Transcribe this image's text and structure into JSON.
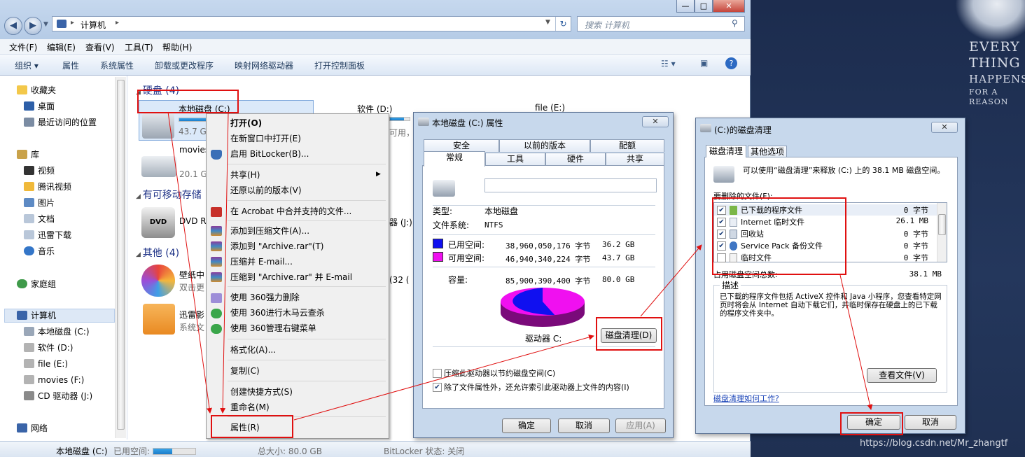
{
  "explorer": {
    "address": "计算机",
    "search_placeholder": "搜索 计算机",
    "menu": [
      "文件(F)",
      "编辑(E)",
      "查看(V)",
      "工具(T)",
      "帮助(H)"
    ],
    "toolbar": [
      "组织 ▾",
      "属性",
      "系统属性",
      "卸载或更改程序",
      "映射网络驱动器",
      "打开控制面板"
    ],
    "nav": {
      "favorites": "收藏夹",
      "fav_items": [
        "桌面",
        "最近访问的位置"
      ],
      "library": "库",
      "lib_items": [
        "视频",
        "腾讯视频",
        "图片",
        "文档",
        "迅雷下载",
        "音乐"
      ],
      "homegroup": "家庭组",
      "computer": "计算机",
      "comp_items": [
        "本地磁盘 (C:)",
        "软件 (D:)",
        "file (E:)",
        "movies (F:)",
        "CD 驱动器 (J:)"
      ],
      "network": "网络"
    },
    "groups": {
      "hdd": "硬盘 (4)",
      "removable": "有可移动存储",
      "other": "其他 (4)"
    },
    "drives": {
      "c_name": "本地磁盘 (C:)",
      "c_free": "43.7 G",
      "d_name": "软件 (D:)",
      "d_free": "可用，",
      "e_name": "file (E:)",
      "f_name": "movies",
      "f_free": "20.1 G",
      "dvd_name": "DVD R",
      "dvd_label": "DVD",
      "j_frag": "器 (J:)",
      "wall_name": "壁纸中",
      "wall_sub": "双击更",
      "wall_count": "(32 (",
      "xl_name": "迅雷影",
      "xl_sub": "系统文"
    },
    "status": {
      "name": "本地磁盘 (C:)",
      "used_label": "已用空间:",
      "used_fraction": 0.45,
      "total": "总大小: 80.0 GB",
      "bitlocker": "BitLocker 状态: 关闭"
    }
  },
  "context_menu": {
    "items": [
      {
        "label": "打开(O)",
        "bold": true
      },
      {
        "label": "在新窗口中打开(E)"
      },
      {
        "label": "启用 BitLocker(B)..."
      },
      {
        "label": "共享(H)",
        "submenu": true
      },
      {
        "label": "还原以前的版本(V)"
      },
      {
        "label": "在 Acrobat 中合并支持的文件..."
      },
      {
        "label": "添加到压缩文件(A)..."
      },
      {
        "label": "添加到 \"Archive.rar\"(T)"
      },
      {
        "label": "压缩并 E-mail..."
      },
      {
        "label": "压缩到 \"Archive.rar\" 并 E-mail"
      },
      {
        "label": "使用 360强力删除"
      },
      {
        "label": "使用 360进行木马云查杀"
      },
      {
        "label": "使用 360管理右键菜单"
      },
      {
        "label": "格式化(A)..."
      },
      {
        "label": "复制(C)"
      },
      {
        "label": "创建快捷方式(S)"
      },
      {
        "label": "重命名(M)"
      },
      {
        "label": "属性(R)"
      }
    ]
  },
  "props": {
    "title": "本地磁盘 (C:) 属性",
    "tabs_back": [
      "安全",
      "以前的版本",
      "配额"
    ],
    "tabs_front": [
      "常规",
      "工具",
      "硬件",
      "共享"
    ],
    "type_label": "类型:",
    "type_value": "本地磁盘",
    "fs_label": "文件系统:",
    "fs_value": "NTFS",
    "used_label": "已用空间:",
    "used_bytes": "38,960,050,176 字节",
    "used_gb": "36.2 GB",
    "free_label": "可用空间:",
    "free_bytes": "46,940,340,224 字节",
    "free_gb": "43.7 GB",
    "cap_label": "容量:",
    "cap_bytes": "85,900,390,400 字节",
    "cap_gb": "80.0 GB",
    "drive_label": "驱动器 C:",
    "cleanup_btn": "磁盘清理(D)",
    "compress": "压缩此驱动器以节约磁盘空间(C)",
    "index": "除了文件属性外，还允许索引此驱动器上文件的内容(I)",
    "ok": "确定",
    "cancel": "取消",
    "apply": "应用(A)",
    "colors": {
      "used": "#1010f0",
      "free": "#f010f0"
    },
    "used_fraction": 0.4535
  },
  "cleanup": {
    "title": "(C:)的磁盘清理",
    "tabs": [
      "磁盘清理",
      "其他选项"
    ],
    "intro": "可以使用“磁盘清理”来释放 (C:) 上的 38.1 MB 磁盘空间。",
    "delete_label": "要删除的文件(F):",
    "files": [
      {
        "name": "已下载的程序文件",
        "size": "0 字节",
        "checked": true
      },
      {
        "name": "Internet 临时文件",
        "size": "26.1 MB",
        "checked": true
      },
      {
        "name": "回收站",
        "size": "0 字节",
        "checked": true
      },
      {
        "name": "Service Pack 备份文件",
        "size": "0 字节",
        "checked": true
      },
      {
        "name": "临时文件",
        "size": "0 字节",
        "checked": false
      }
    ],
    "total_label": "占用磁盘空间总数:",
    "total": "38.1 MB",
    "desc_label": "描述",
    "desc": "已下载的程序文件包括 ActiveX 控件和 Java 小程序，您查看特定网页时将会从 Internet 自动下载它们，并临时保存在硬盘上的已下载的程序文件夹中。",
    "view_btn": "查看文件(V)",
    "help_link": "磁盘清理如何工作?",
    "ok": "确定",
    "cancel": "取消"
  },
  "wallpaper": {
    "lines": [
      "EVERY",
      "THING",
      "HAPPENS"
    ],
    "small": "FOR A REASON"
  },
  "watermark": "https://blog.csdn.net/Mr_zhangtf"
}
